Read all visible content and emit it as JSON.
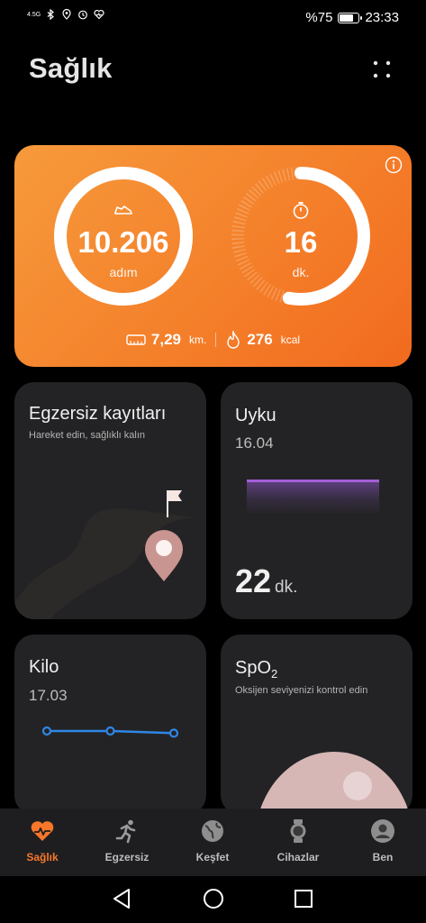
{
  "status_bar": {
    "network": "4.5G",
    "battery": "%75",
    "battery_level": 0.75,
    "time": "23:33",
    "icons": [
      "network-icon",
      "bluetooth-icon",
      "location-icon",
      "alarm-icon",
      "heart-icon",
      "battery-icon"
    ]
  },
  "header": {
    "title": "Sağlık",
    "more_icon": "more-dots-icon"
  },
  "activity": {
    "steps_value": "10.206",
    "steps_unit": "adım",
    "steps_progress": 1.0,
    "minutes_value": "16",
    "minutes_unit": "dk.",
    "minutes_progress": 0.53,
    "distance_value": "7,29",
    "distance_unit": "km.",
    "calories_value": "276",
    "calories_unit": "kcal",
    "accent": "#f47e29"
  },
  "tiles": {
    "exercise": {
      "title": "Egzersiz kayıtları",
      "subtitle": "Hareket edin, sağlıklı kalın"
    },
    "sleep": {
      "title": "Uyku",
      "date": "16.04",
      "value": "22",
      "unit": "dk.",
      "bar_color": "#a35fd6"
    },
    "weight": {
      "title": "Kilo",
      "date": "17.03",
      "line_color": "#2f86e6",
      "points": [
        1.0,
        1.0,
        0.96
      ]
    },
    "spo2": {
      "title_main": "SpO",
      "title_sub": "2",
      "subtitle": "Oksijen seviyenizi kontrol edin"
    }
  },
  "nav": {
    "items": [
      {
        "label": "Sağlık",
        "icon": "heart-pulse-icon",
        "active": true
      },
      {
        "label": "Egzersiz",
        "icon": "running-icon",
        "active": false
      },
      {
        "label": "Keşfet",
        "icon": "globe-icon",
        "active": false
      },
      {
        "label": "Cihazlar",
        "icon": "watch-icon",
        "active": false
      },
      {
        "label": "Ben",
        "icon": "profile-icon",
        "active": false
      }
    ]
  },
  "system_nav": {
    "back": "back-icon",
    "home": "home-icon",
    "recents": "recents-icon"
  }
}
